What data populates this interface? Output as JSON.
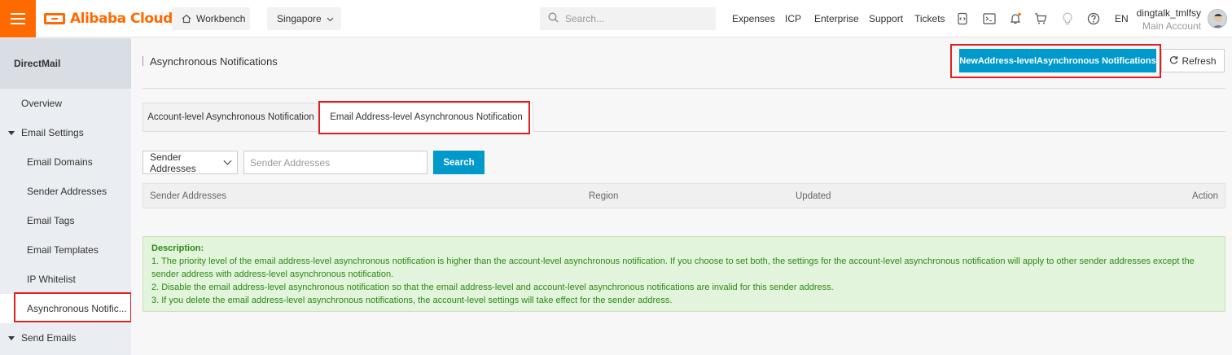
{
  "topbar": {
    "brand": "Alibaba Cloud",
    "workbench": "Workbench",
    "region": "Singapore",
    "search_placeholder": "Search...",
    "links": [
      "Expenses",
      "ICP",
      "Enterprise",
      "Support",
      "Tickets"
    ],
    "lang": "EN",
    "user_name": "dingtalk_tmlfsy",
    "user_role": "Main Account",
    "accent": "#ff6a00"
  },
  "sidebar": {
    "title": "DirectMail",
    "overview": "Overview",
    "email_settings": "Email Settings",
    "items": [
      "Email Domains",
      "Sender Addresses",
      "Email Tags",
      "Email Templates",
      "IP Whitelist",
      "Asynchronous Notific..."
    ],
    "send_emails": "Send Emails"
  },
  "main": {
    "title": "Asynchronous Notifications",
    "new_button": "NewAddress-levelAsynchronous Notifications",
    "refresh_button": "Refresh",
    "tabs": [
      "Account-level Asynchronous Notification",
      "Email Address-level Asynchronous Notification"
    ],
    "filter_select": "Sender Addresses",
    "filter_placeholder": "Sender Addresses",
    "search_button": "Search",
    "columns": [
      "Sender Addresses",
      "Region",
      "Updated",
      "Action"
    ],
    "description": {
      "title": "Description:",
      "lines": [
        "1. The priority level of the email address-level asynchronous notification is higher than the account-level asynchronous notification. If you choose to set both, the settings for the account-level asynchronous notification will apply to other sender addresses except the sender address with address-level asynchronous notification.",
        "2. Disable the email address-level asynchronous notification so that the email address-level and account-level asynchronous notifications are invalid for this sender address.",
        "3. If you delete the email address-level asynchronous notifications, the account-level settings will take effect for the sender address."
      ]
    },
    "primary_color": "#0099cc",
    "highlight_color": "#e02020"
  }
}
